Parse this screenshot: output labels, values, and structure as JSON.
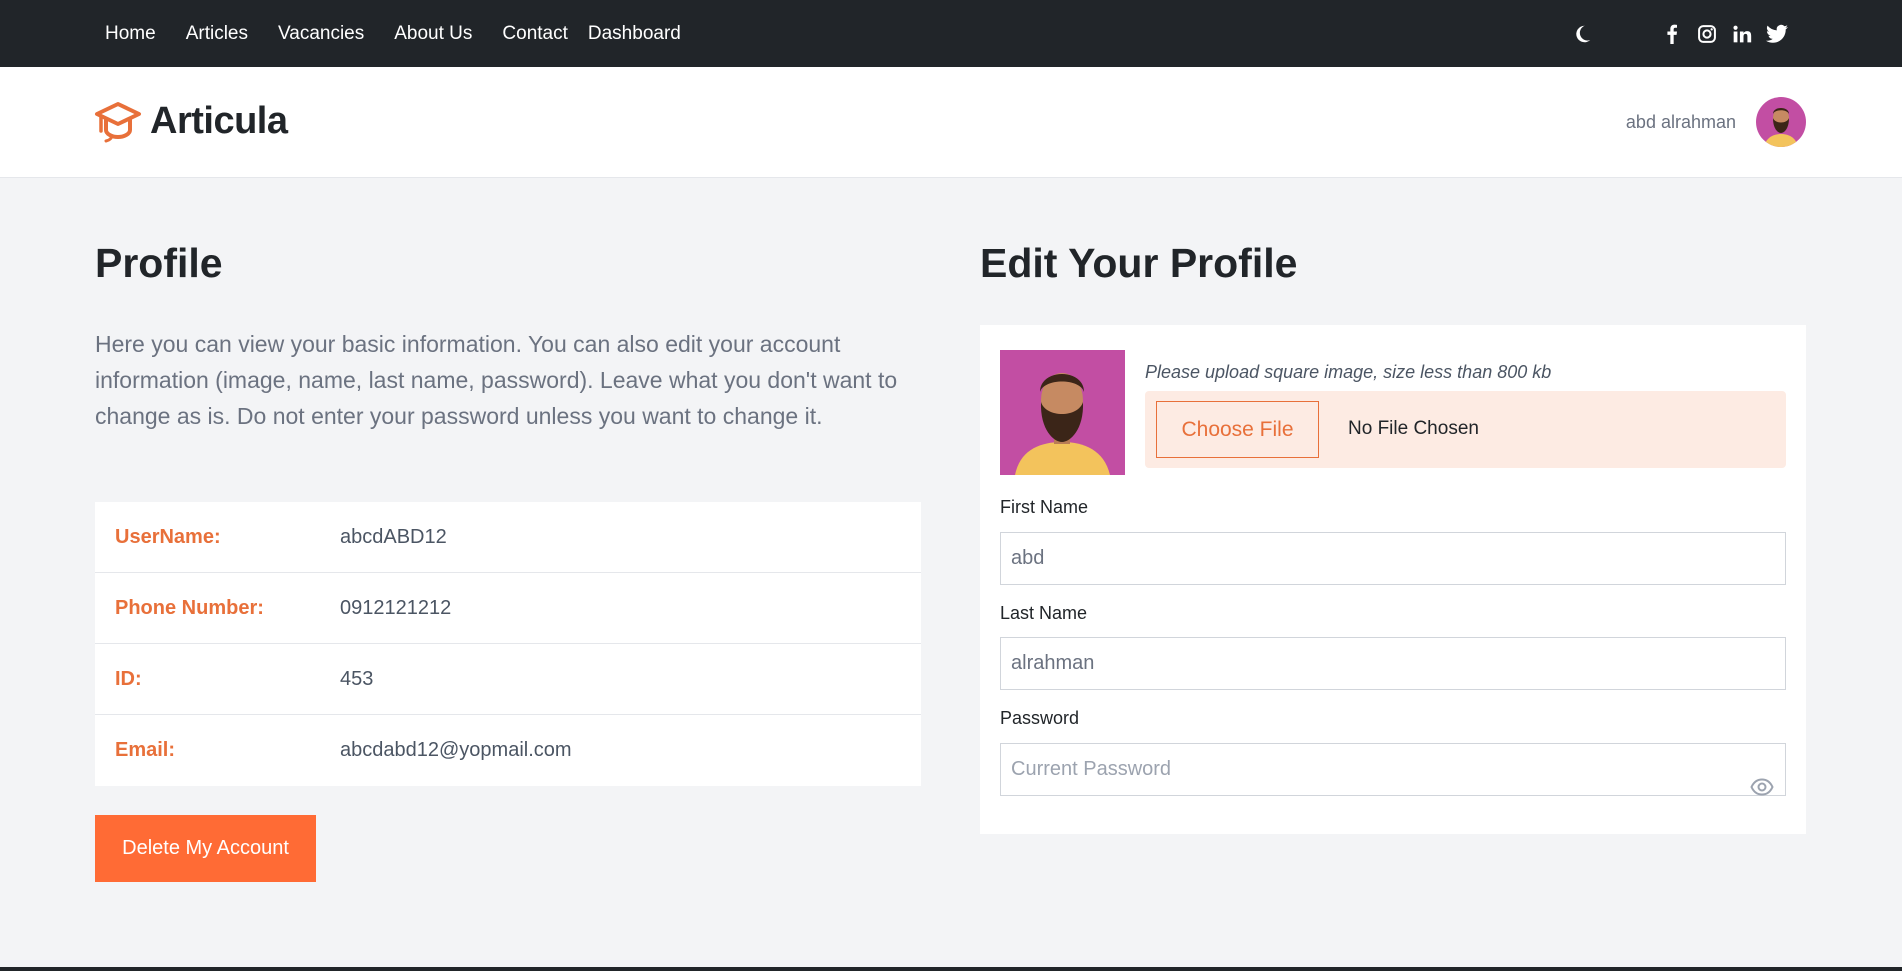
{
  "nav": {
    "links": [
      "Home",
      "Articles",
      "Vacancies",
      "About Us",
      "Contact",
      "Dashboard"
    ]
  },
  "icons": {
    "theme": "moon-icon",
    "social": [
      "facebook-icon",
      "instagram-icon",
      "linkedin-icon",
      "twitter-icon"
    ],
    "logo": "graduation-cap-icon",
    "password_toggle": "eye-icon"
  },
  "colors": {
    "accent": "#ff6b35",
    "label": "#e8703a",
    "topbar": "#212529"
  },
  "header": {
    "brand": "Articula",
    "user_name": "abd alrahman"
  },
  "profile": {
    "title": "Profile",
    "description": "Here you can view your basic information. You can also edit your account information (image, name, last name, password). Leave what you don't want to change as is. Do not enter your password unless you want to change it.",
    "rows": [
      {
        "label": "UserName:",
        "value": "abcdABD12"
      },
      {
        "label": "Phone Number:",
        "value": "0912121212"
      },
      {
        "label": "ID:",
        "value": "453"
      },
      {
        "label": "Email:",
        "value": "abcdabd12@yopmail.com"
      }
    ],
    "delete_label": "Delete My Account"
  },
  "edit": {
    "title": "Edit Your Profile",
    "upload_hint": "Please upload square image, size less than 800 kb",
    "choose_label": "Choose File",
    "no_file": "No File Chosen",
    "first_name_label": "First Name",
    "first_name_value": "abd",
    "last_name_label": "Last Name",
    "last_name_value": "alrahman",
    "password_label": "Password",
    "password_placeholder": "Current Password"
  }
}
